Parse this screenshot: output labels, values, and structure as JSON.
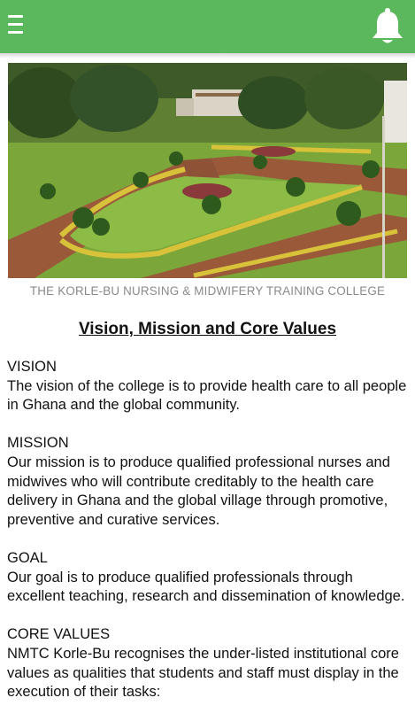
{
  "appbar": {
    "menu_icon": "hamburger-menu-icon",
    "notification_icon": "bell-icon",
    "color": "#5cb85c"
  },
  "banner": {
    "caption": "THE KORLE-BU NURSING & MIDWIFERY TRAINING COLLEGE"
  },
  "page": {
    "heading": "Vision, Mission and Core Values"
  },
  "sections": [
    {
      "title": "VISION",
      "body": "The vision of the college is to provide health care to all people in Ghana and the global community."
    },
    {
      "title": "MISSION",
      "body": "Our mission is to produce qualified professional nurses and midwives who will contribute creditably to the health care delivery in Ghana and the global village through promotive, preventive and curative services."
    },
    {
      "title": "GOAL",
      "body": "Our goal is to produce qualified professionals through excellent teaching, research and dissemination of knowledge."
    },
    {
      "title": "CORE VALUES",
      "body": "NMTC Korle-Bu recognises the under-listed institutional core values as qualities that students and staff must display in the execution of their tasks:"
    }
  ]
}
